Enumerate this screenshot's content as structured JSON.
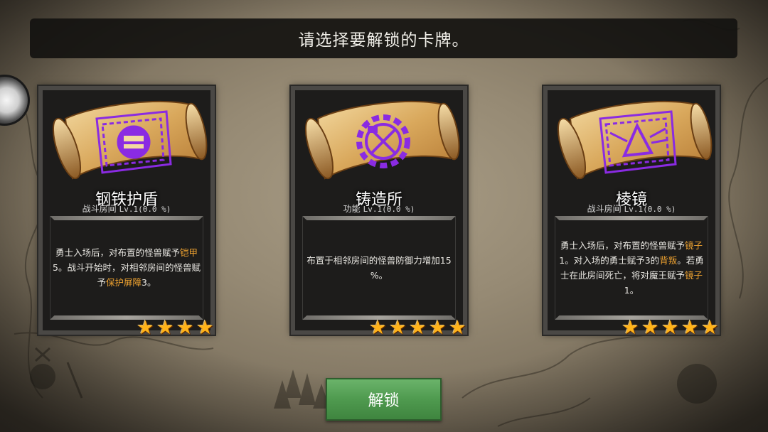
{
  "header": {
    "title": "请选择要解锁的卡牌。"
  },
  "cards": [
    {
      "name": "钢铁护盾",
      "category": "战斗房间",
      "level": "Lv.1(0.0 %)",
      "icon": "shield-helmet-icon",
      "desc_parts": [
        "勇士入场后，对布置的怪兽赋予",
        "铠甲",
        "5。战斗开始时，对相邻房间的怪兽赋予",
        "保护屏障",
        "3。"
      ],
      "stars": 4
    },
    {
      "name": "铸造所",
      "category": "功能",
      "level": "Lv.1(0.0 %)",
      "icon": "gear-hammer-icon",
      "desc_parts": [
        "布置于相邻房间的怪兽防御力增加15 %。"
      ],
      "stars": 5
    },
    {
      "name": "棱镜",
      "category": "战斗房间",
      "level": "Lv.1(0.0 %)",
      "icon": "prism-icon",
      "desc_parts": [
        "勇士入场后，对布置的怪兽赋予",
        "镜子",
        "1。对入场的勇士赋予3的",
        "背叛",
        "。若勇士在此房间死亡，将对魔王赋予",
        "镜子",
        " 1。"
      ],
      "stars": 5
    }
  ],
  "star_glyph": "★",
  "actions": {
    "unlock_label": "解锁"
  },
  "colors": {
    "highlight": "#f0a330",
    "button_green": "#4f9a4f",
    "icon_purple": "#8a2be2"
  }
}
